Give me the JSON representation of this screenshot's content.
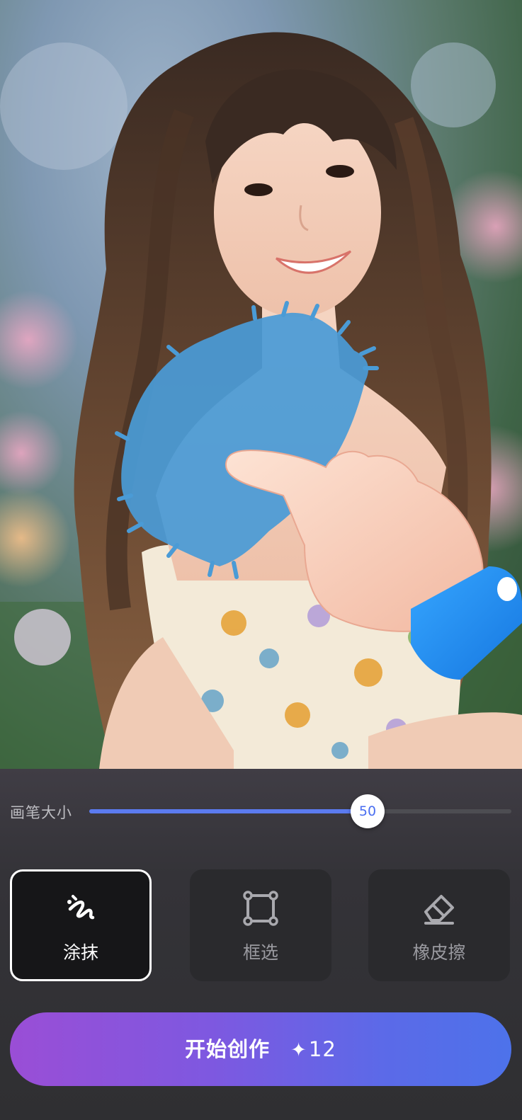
{
  "colors": {
    "accent": "#5b7bf0",
    "brush_mask": "#4a9bd6",
    "button_gradient_start": "#9a4ed6",
    "button_gradient_end": "#4d72ea",
    "panel_bg": "#2f2f32"
  },
  "canvas": {
    "content": "portrait photo",
    "overlay": "blue brush mask",
    "hint": "pointing-hand-icon"
  },
  "brush_size": {
    "label": "画笔大小",
    "value": "50",
    "level_fraction": 0.66
  },
  "tools": [
    {
      "label": "涂抹",
      "icon": "smear-brush-icon",
      "active": true
    },
    {
      "label": "框选",
      "icon": "box-select-icon",
      "active": false
    },
    {
      "label": "橡皮擦",
      "icon": "eraser-icon",
      "active": false
    }
  ],
  "start_button": {
    "label": "开始创作",
    "icon": "sparkle-icon",
    "cost": "12"
  }
}
